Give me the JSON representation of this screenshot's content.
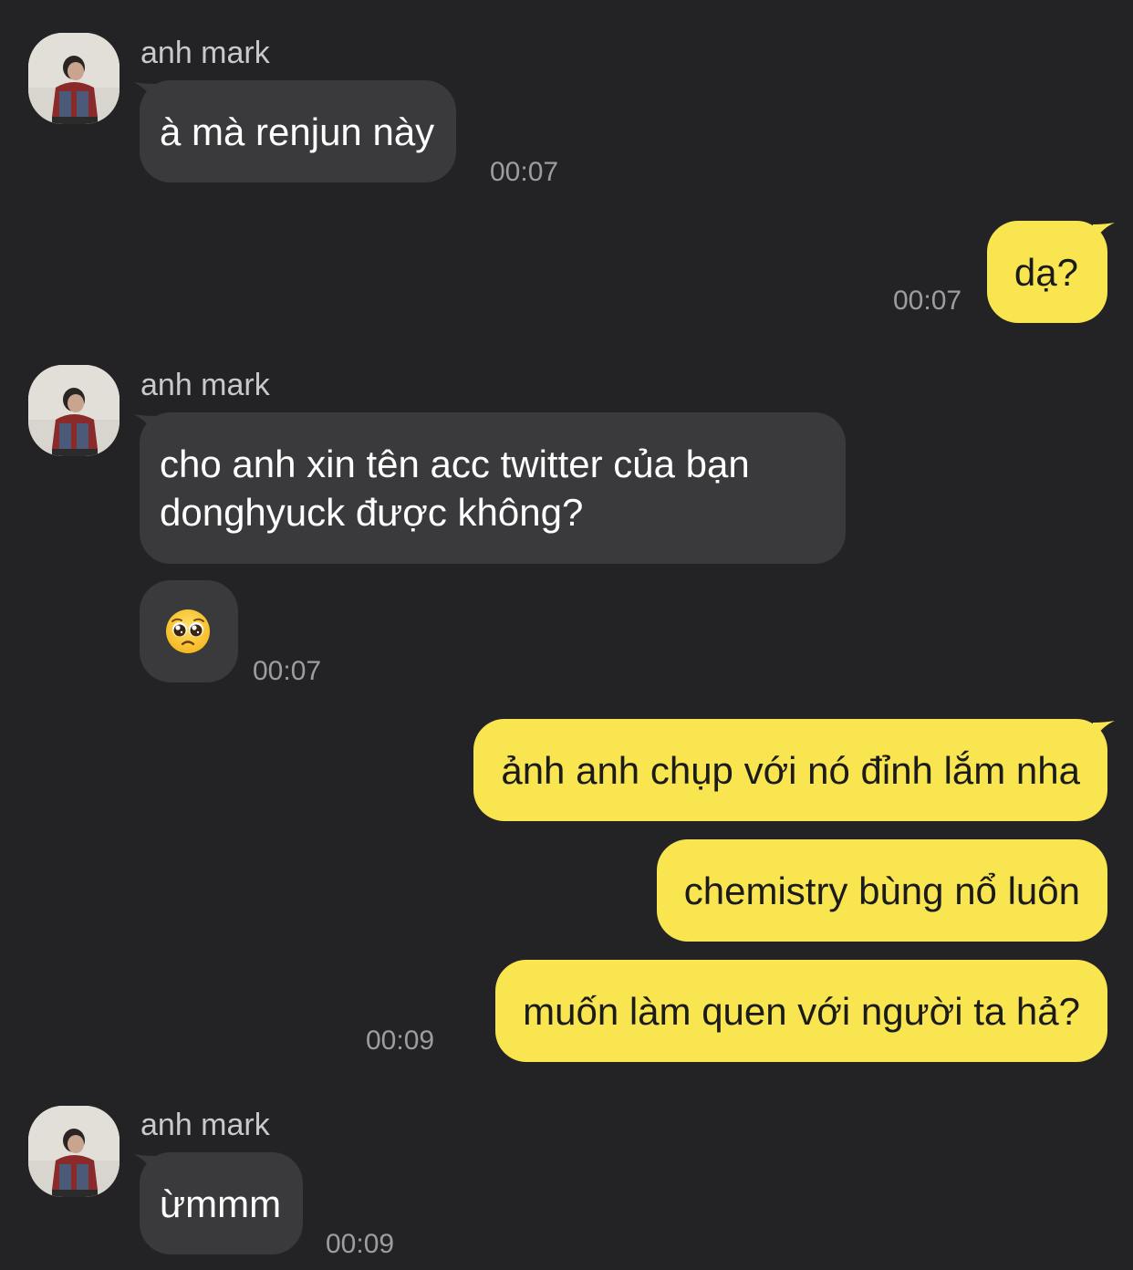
{
  "colors": {
    "background": "#232325",
    "incoming_bubble": "#3a3a3c",
    "outgoing_bubble": "#f8e54f",
    "timestamp": "#9d9da0"
  },
  "messages": [
    {
      "direction": "in",
      "sender": "anh mark",
      "text": "à mà renjun này",
      "time": "00:07"
    },
    {
      "direction": "out",
      "text": "dạ?",
      "time": "00:07"
    },
    {
      "direction": "in",
      "sender": "anh mark",
      "text_line1": "cho anh xin tên acc twitter của bạn",
      "text_line2": "donghyuck được không?"
    },
    {
      "direction": "in",
      "emoji": "pleading-face",
      "time": "00:07"
    },
    {
      "direction": "out",
      "text": "ảnh anh chụp với nó đỉnh lắm nha"
    },
    {
      "direction": "out",
      "text": "chemistry bùng nổ luôn"
    },
    {
      "direction": "out",
      "text": "muốn làm quen với người ta hả?",
      "time": "00:09"
    },
    {
      "direction": "in",
      "sender": "anh mark",
      "text": "ừmmm",
      "time": "00:09"
    }
  ]
}
